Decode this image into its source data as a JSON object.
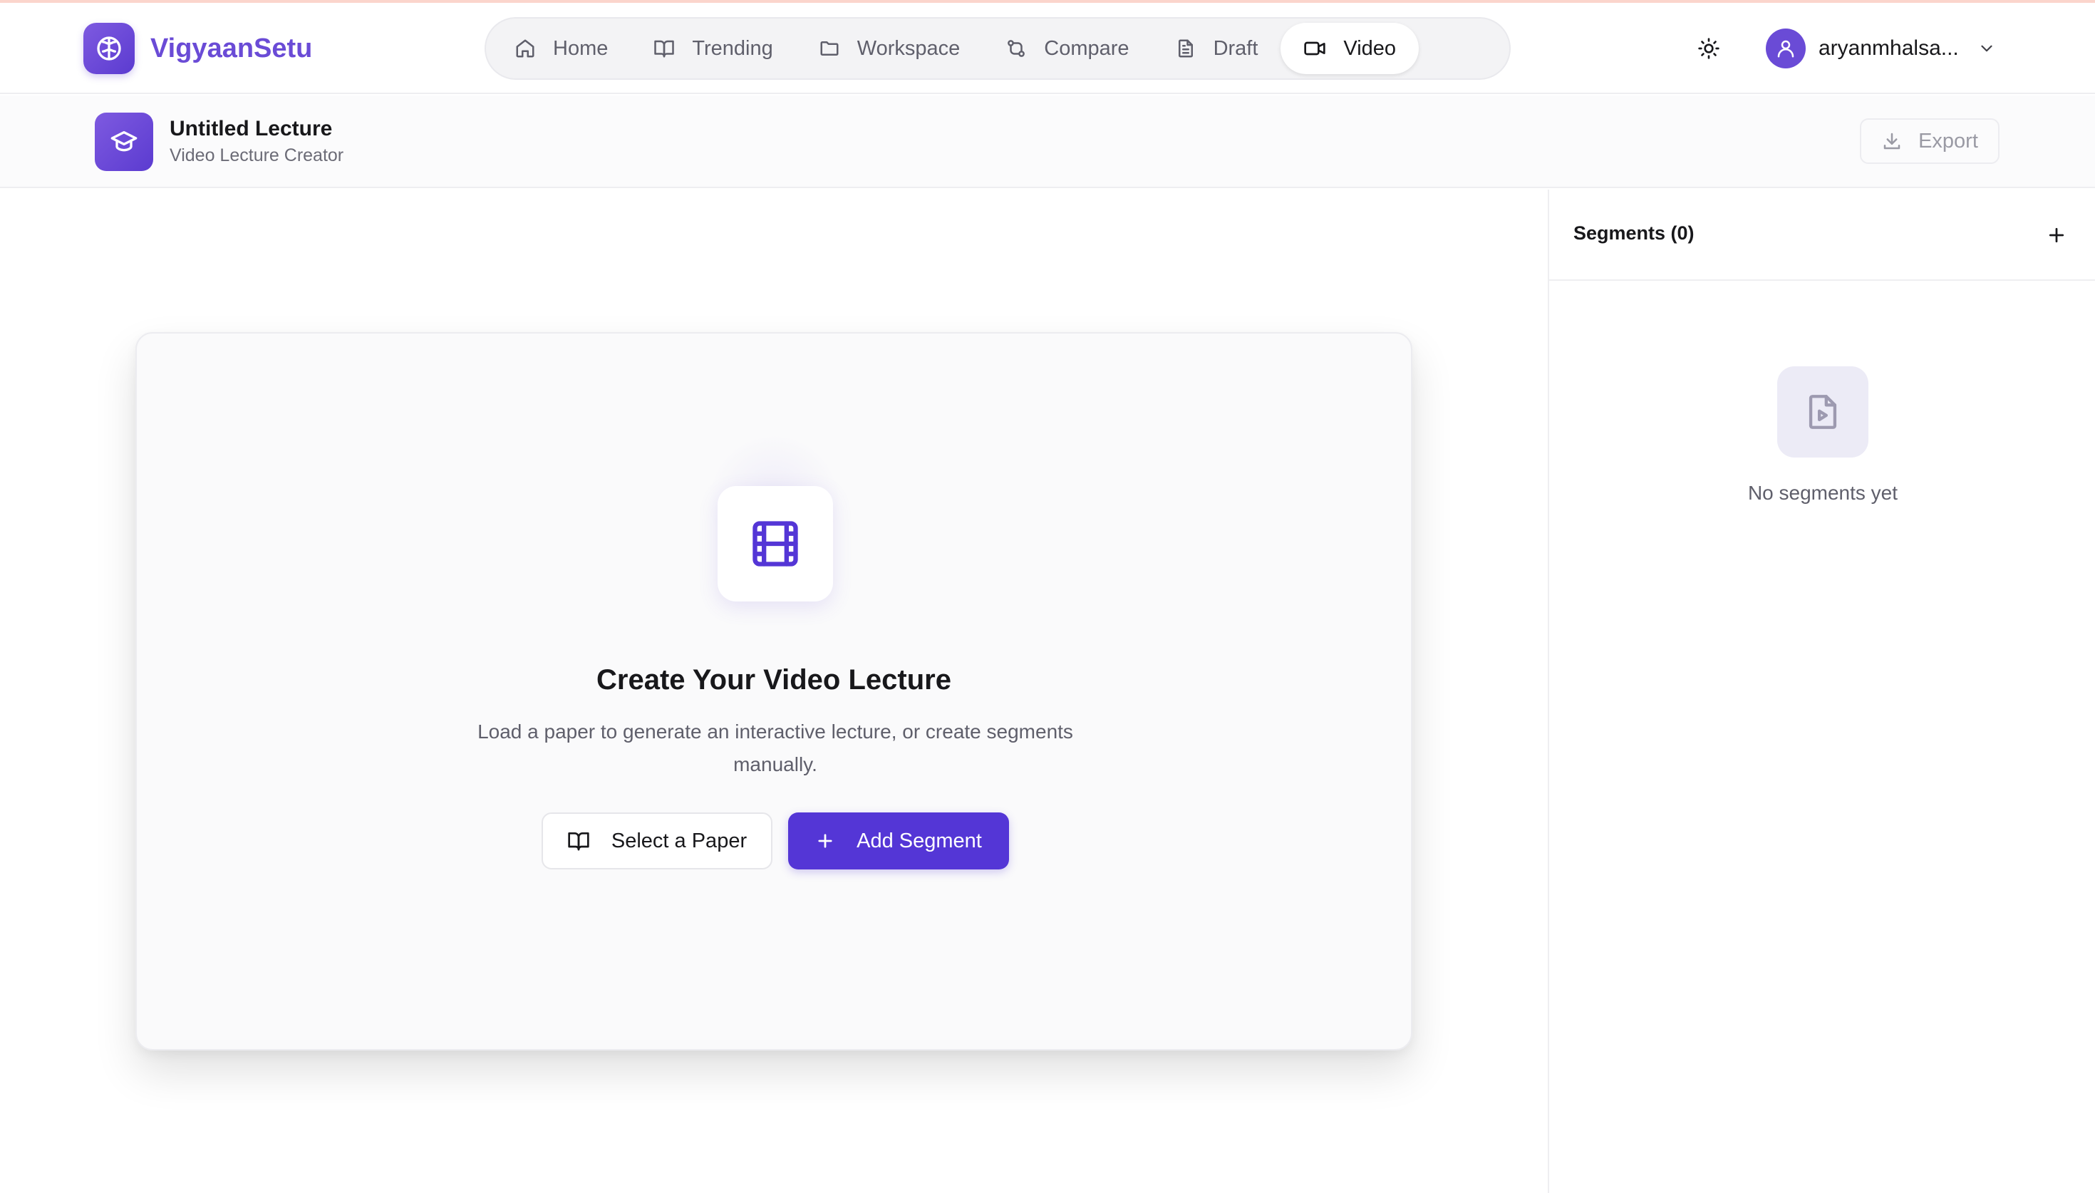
{
  "brand": {
    "name": "VigyaanSetu",
    "logo_icon": "brain-icon",
    "accent": "#6a4bd6"
  },
  "nav": {
    "items": [
      {
        "label": "Home",
        "icon": "home-icon"
      },
      {
        "label": "Trending",
        "icon": "book-open-icon"
      },
      {
        "label": "Workspace",
        "icon": "folder-icon"
      },
      {
        "label": "Compare",
        "icon": "git-compare-icon"
      },
      {
        "label": "Draft",
        "icon": "document-icon"
      },
      {
        "label": "Video",
        "icon": "video-icon",
        "active": true
      }
    ]
  },
  "header": {
    "theme_icon": "sun-icon",
    "user_name": "aryanmhalsa...",
    "user_icon": "user-icon"
  },
  "subheader": {
    "title": "Untitled Lecture",
    "subtitle": "Video Lecture Creator",
    "export_label": "Export"
  },
  "main": {
    "title": "Create Your Video Lecture",
    "description": "Load a paper to generate an interactive lecture, or create segments manually.",
    "select_paper_label": "Select a Paper",
    "add_segment_label": "Add Segment"
  },
  "sidebar": {
    "title": "Segments (0)",
    "empty_text": "No segments yet"
  },
  "colors": {
    "primary_button": "#5436d6",
    "brand": "#6a4bd6"
  }
}
